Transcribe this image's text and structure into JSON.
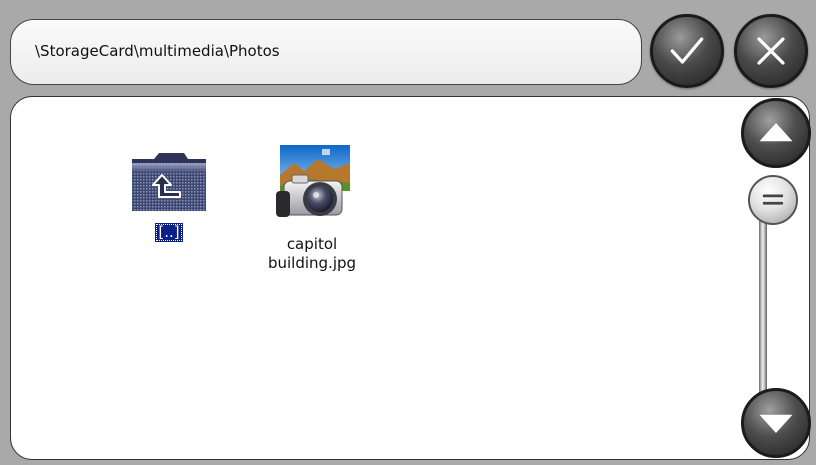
{
  "path_bar": {
    "path": "\\StorageCard\\multimedia\\Photos"
  },
  "toolbar": {
    "ok_icon": "checkmark-icon",
    "cancel_icon": "close-icon"
  },
  "files": [
    {
      "label": "[..]",
      "icon": "parent-folder-icon",
      "selected": true
    },
    {
      "label": "capitol building.jpg",
      "icon": "photo-camera-icon",
      "selected": false
    }
  ],
  "scrollbar": {
    "up_icon": "arrow-up-icon",
    "down_icon": "arrow-down-icon",
    "thumb_icon": "scroll-thumb-grip-icon",
    "position": 0
  },
  "colors": {
    "selection": "#0b1f86",
    "background": "#a9a9a9",
    "panel": "#ffffff"
  }
}
